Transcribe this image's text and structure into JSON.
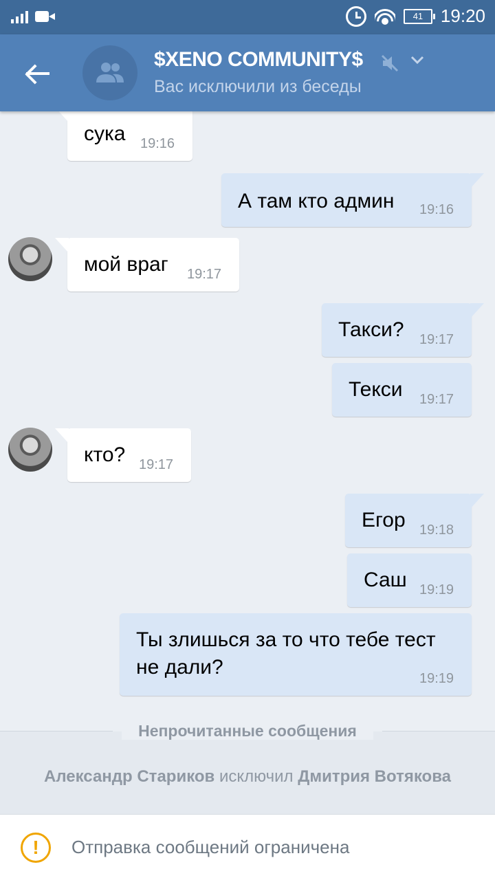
{
  "status_bar": {
    "time": "19:20",
    "battery": "41"
  },
  "header": {
    "title": "$XENO COMMUNITY$",
    "subtitle": "Вас исключили из беседы"
  },
  "messages": [
    {
      "direction": "in",
      "text": "сука",
      "time": "19:16"
    },
    {
      "direction": "out",
      "text": "А там кто админ",
      "time": "19:16"
    },
    {
      "direction": "in",
      "text": "мой враг",
      "time": "19:17"
    },
    {
      "direction": "out",
      "text": "Такси?",
      "time": "19:17"
    },
    {
      "direction": "out",
      "text": "Текси",
      "time": "19:17"
    },
    {
      "direction": "in",
      "text": "кто?",
      "time": "19:17"
    },
    {
      "direction": "out",
      "text": "Егор",
      "time": "19:18"
    },
    {
      "direction": "out",
      "text": "Саш",
      "time": "19:19"
    },
    {
      "direction": "out",
      "text_line1": "Ты злишься за то что тебе тест",
      "text_line2": "не дали?",
      "time": "19:19"
    }
  ],
  "unread_divider": "Непрочитанные сообщения",
  "service_message": {
    "actor": "Александр Стариков",
    "action": "исключил",
    "target": "Дмитрия Вотякова"
  },
  "composer_notice": "Отправка сообщений ограничена",
  "colors": {
    "header": "#5181b8",
    "statusbar": "#3e6a99",
    "outgoing_bubble": "#d9e6f6",
    "warning": "#f0a500"
  }
}
